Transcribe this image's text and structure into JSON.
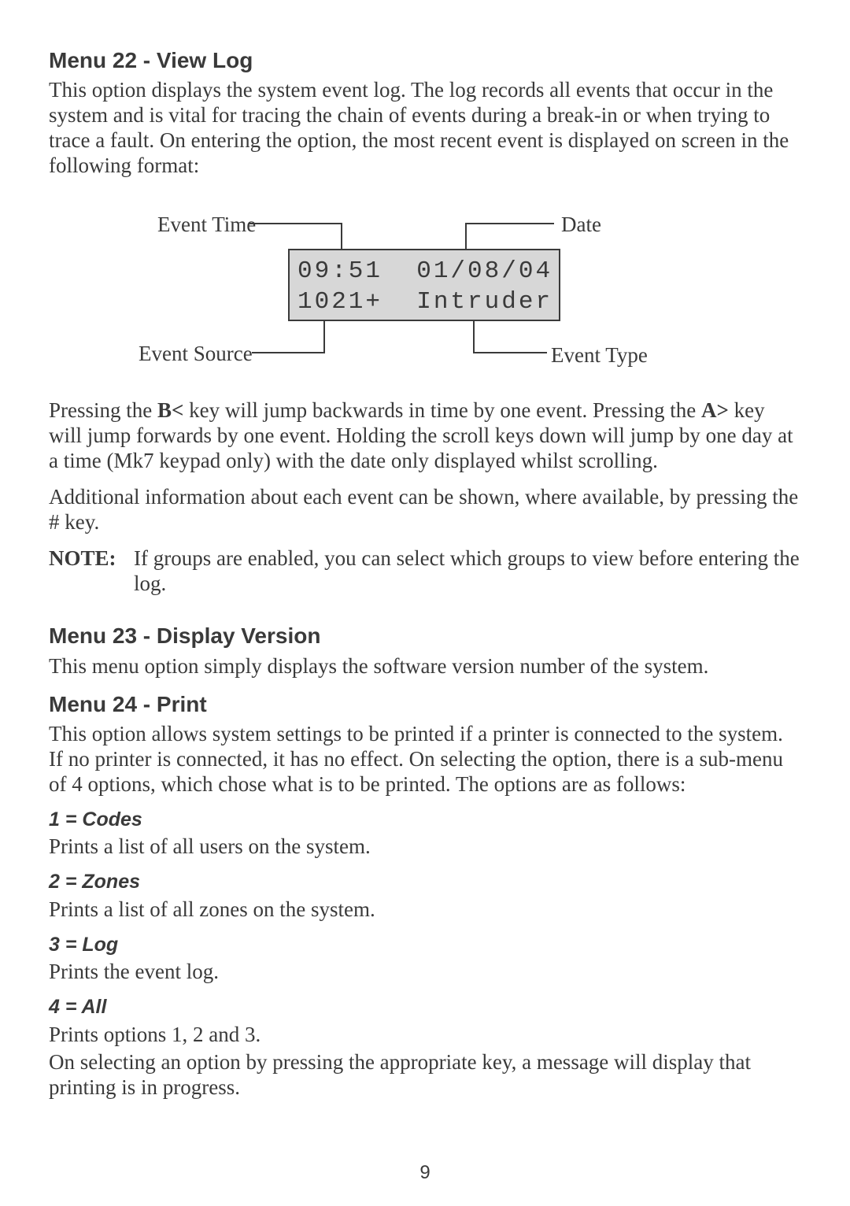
{
  "menu22": {
    "heading": "Menu 22 - View Log",
    "p1": "This option displays the system event log. The log records all events that occur in the system and is vital for tracing the chain of events during a break-in or when trying to trace a fault. On entering the option, the most recent event is displayed on screen in the following format:",
    "diagram": {
      "labels": {
        "event_time": "Event Time",
        "date": "Date",
        "event_source": "Event Source",
        "event_type": "Event Type"
      },
      "lcd_line1": "09:51  01/08/04",
      "lcd_line2": "1021+  Intruder"
    },
    "p2a": "Pressing the ",
    "p2b_bold": "B<",
    "p2c": " key will jump backwards in time by one event. Pressing the ",
    "p2d_bold": "A>",
    "p2e": " key will jump forwards by one event.  Holding the scroll keys down will jump by one day at a time (Mk7 keypad only) with the date only displayed whilst scrolling.",
    "p3": "Additional information about each event can be shown, where available, by pressing the # key.",
    "note_label": "NOTE:",
    "note_text": "If groups are enabled, you can select which groups to view before entering the log."
  },
  "menu23": {
    "heading": "Menu 23 - Display Version",
    "p1": "This menu option simply displays the software version number of the system."
  },
  "menu24": {
    "heading": "Menu 24 - Print",
    "p1": "This option allows system settings to be printed if a printer is connected to the system. If no printer is connected, it has no effect. On selecting the option, there is a sub-menu of 4 options, which chose what is to be printed. The options are as follows:",
    "opt1_h": "1 = Codes",
    "opt1_p": "Prints a list of all users on the system.",
    "opt2_h": "2 = Zones",
    "opt2_p": "Prints a list of all zones on the system.",
    "opt3_h": "3 = Log",
    "opt3_p": "Prints the event log.",
    "opt4_h": "4 = All",
    "opt4_p": "Prints options 1, 2 and 3.",
    "p2": "On selecting an option by pressing the appropriate key, a message will display that printing is in progress."
  },
  "page_number": "9"
}
